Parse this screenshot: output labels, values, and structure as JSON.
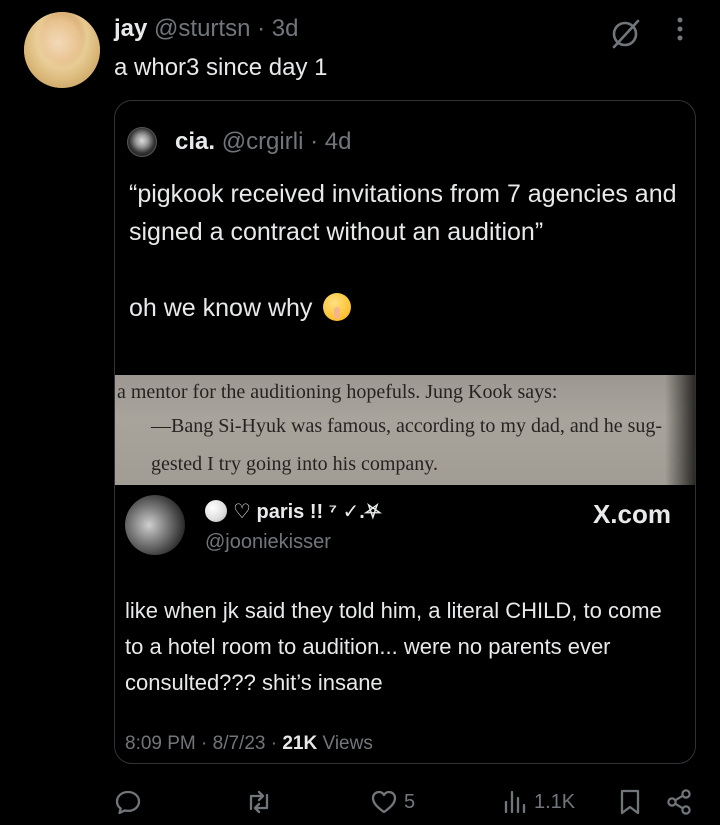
{
  "post": {
    "author_name": "jay",
    "author_handle": "@sturtsn",
    "separator": "·",
    "age": "3d",
    "text": "a whor3 since day 1"
  },
  "quote": {
    "author_name": "cia.",
    "author_handle": "@crgirli",
    "separator": "·",
    "age": "4d",
    "text_line1": "“pigkook received invitations from 7 agencies and signed a contract without an audition”",
    "text_line2": "oh we know why",
    "emoji": "shushing-face",
    "book_image": {
      "line1": "a mentor for the auditioning hopefuls. Jung Kook says:",
      "line2": "—Bang Si-Hyuk was famous, according to my dad, and he sug-",
      "line3": "gested I try going into his company."
    },
    "embed": {
      "name": "♡ paris !! ⁷ ✓.⛧",
      "handle": "@jooniekisser",
      "source": "X.com",
      "text": "like when jk said they told him, a literal CHILD, to come to a hotel room to audition... were no parents ever consulted??? shit’s insane",
      "time": "8:09 PM · 8/7/23 · ",
      "views_count": "21K",
      "views_label": " Views"
    }
  },
  "actions": {
    "reply_count": "",
    "repost_count": "",
    "like_count": "5",
    "views_count": "1.1K"
  },
  "colors": {
    "background": "#000000",
    "text": "#e7e9ea",
    "muted": "#71767b",
    "border": "#2f3336"
  }
}
